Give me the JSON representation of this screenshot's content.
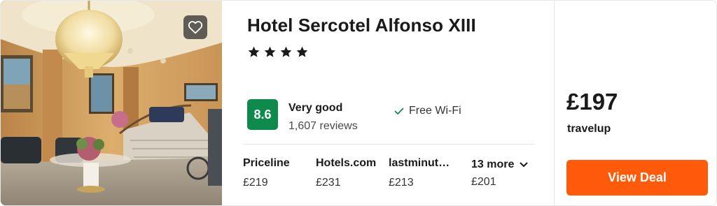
{
  "hotel": {
    "name": "Hotel Sercotel Alfonso XIII",
    "star_rating": 4,
    "stars": [
      "★",
      "★",
      "★",
      "★"
    ]
  },
  "rating": {
    "score": "8.6",
    "label": "Very good",
    "reviews": "1,607 reviews",
    "badge_color": "#0f8a4d"
  },
  "amenities": [
    {
      "label": "Free Wi-Fi",
      "icon": "check-icon"
    }
  ],
  "providers": [
    {
      "name": "Priceline",
      "price": "£219"
    },
    {
      "name": "Hotels.com",
      "price": "£231"
    },
    {
      "name": "lastminute.com",
      "price": "£213"
    }
  ],
  "more": {
    "label": "13 more",
    "price": "£201",
    "icon": "chevron-down-icon"
  },
  "deal": {
    "price": "£197",
    "provider": "travelup",
    "button_label": "View Deal",
    "button_color": "#ff5b0b"
  },
  "image": {
    "favorite_icon": "heart-icon"
  }
}
